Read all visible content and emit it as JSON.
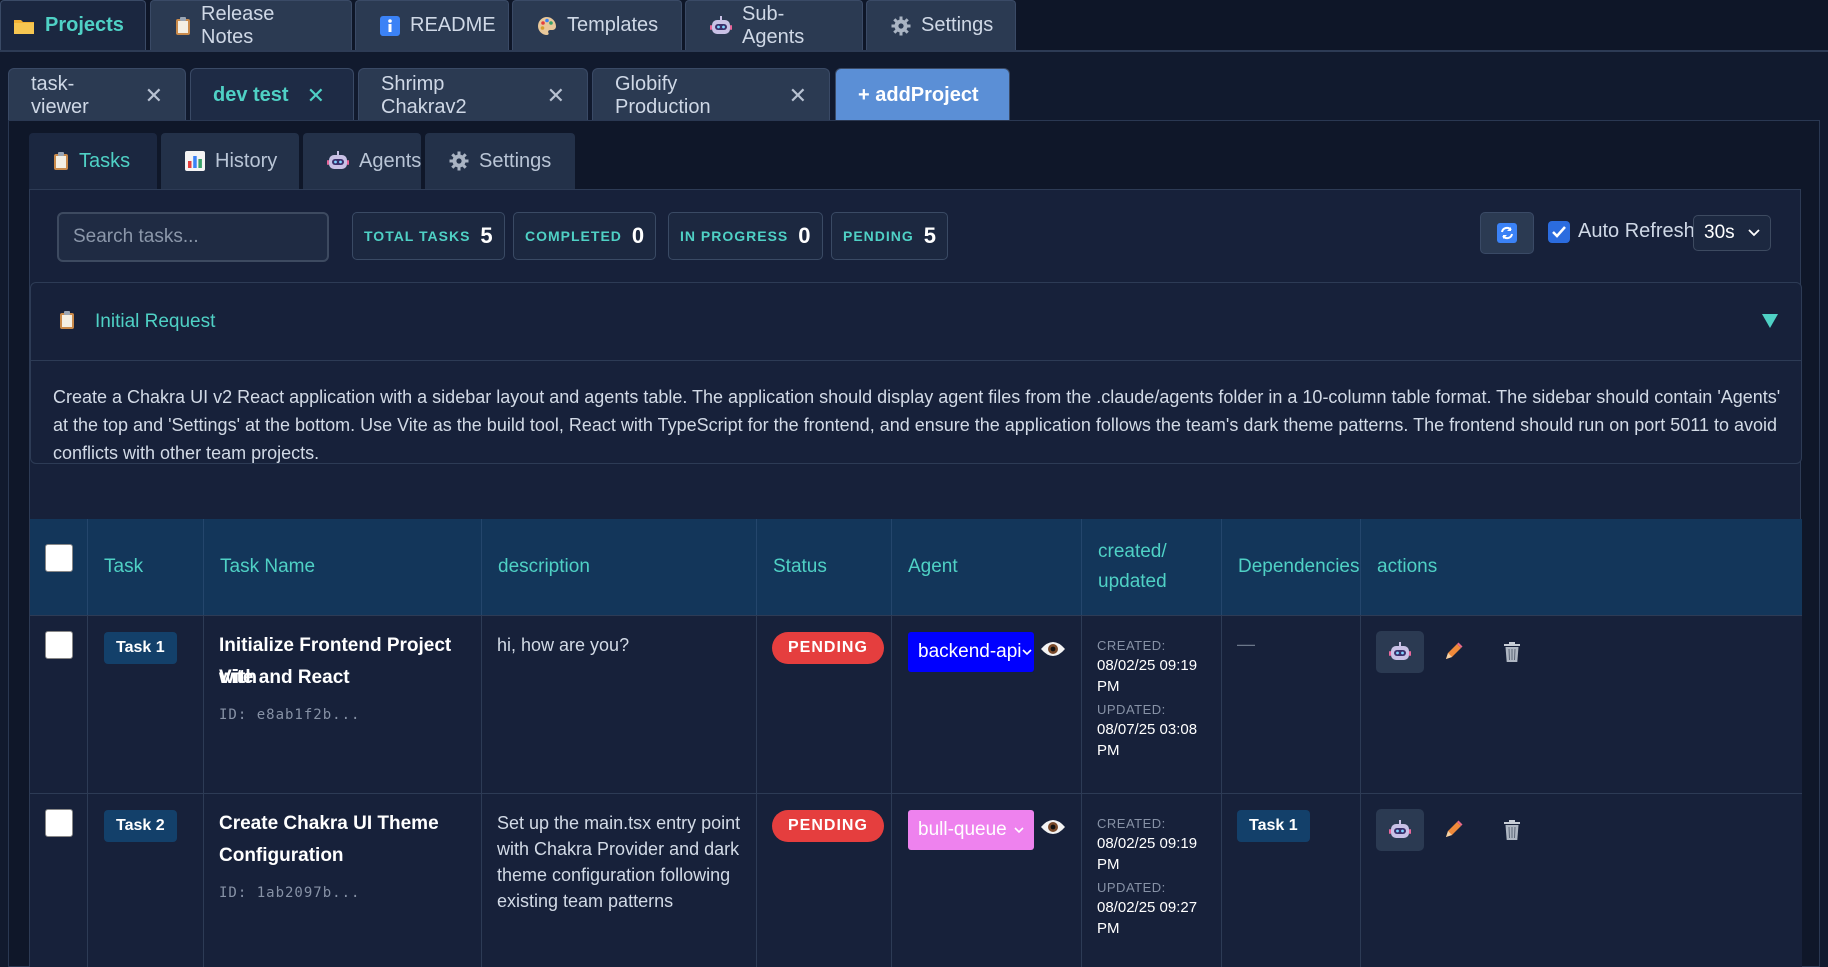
{
  "top_nav": {
    "brand": "Projects",
    "tabs": [
      {
        "label": "Release Notes",
        "icon": "clipboard-icon"
      },
      {
        "label": "README",
        "icon": "info-icon"
      },
      {
        "label": "Templates",
        "icon": "palette-icon"
      },
      {
        "label": "Sub-Agents",
        "icon": "robot-icon"
      },
      {
        "label": "Settings",
        "icon": "gear-icon"
      }
    ]
  },
  "project_tabs": [
    {
      "label": "task-viewer",
      "active": false
    },
    {
      "label": "dev test",
      "active": true
    },
    {
      "label": "Shrimp Chakrav2",
      "active": false
    },
    {
      "label": "Globify Production",
      "active": false
    }
  ],
  "add_project_label": "+ addProject",
  "inner_tabs": [
    {
      "label": "Tasks",
      "icon": "clipboard-icon",
      "active": true
    },
    {
      "label": "History",
      "icon": "bar-chart-icon",
      "active": false
    },
    {
      "label": "Agents",
      "icon": "robot-icon",
      "active": false
    },
    {
      "label": "Settings",
      "icon": "gear-icon",
      "active": false
    }
  ],
  "toolbar": {
    "search_placeholder": "Search tasks...",
    "stats": [
      {
        "label": "TOTAL TASKS",
        "value": "5"
      },
      {
        "label": "COMPLETED",
        "value": "0"
      },
      {
        "label": "IN PROGRESS",
        "value": "0"
      },
      {
        "label": "PENDING",
        "value": "5"
      }
    ],
    "auto_refresh_label": "Auto Refresh",
    "auto_refresh_checked": true,
    "interval": "30s"
  },
  "initial_request": {
    "title": "Initial Request",
    "body": "Create a Chakra UI v2 React application with a sidebar layout and agents table. The application should display agent files from the .claude/agents folder in a 10-column table format. The sidebar should contain 'Agents' at the top and 'Settings' at the bottom. Use Vite as the build tool, React with TypeScript for the frontend, and ensure the application follows the team's dark theme patterns. The frontend should run on port 5011 to avoid conflicts with other team projects."
  },
  "table": {
    "headers": {
      "task": "Task",
      "name": "Task Name",
      "description": "description",
      "status": "Status",
      "agent": "Agent",
      "created_line1": "created/",
      "created_line2": "updated",
      "dependencies": "Dependencies",
      "actions": "actions"
    },
    "rows": [
      {
        "task": "Task 1",
        "name_line1": "Initialize Frontend Project with",
        "name_line2": "Vite and React",
        "id": "ID: e8ab1f2b...",
        "desc_line1": "hi, how are you?",
        "desc_line2": "",
        "desc_line3": "",
        "desc_line4": "",
        "status": "PENDING",
        "agent": "backend-api",
        "agent_bg": "#0000ff",
        "agent_fg": "#ffffff",
        "created_label": "CREATED:",
        "created": "08/02/25 09:19 PM",
        "updated_label": "UPDATED:",
        "updated": "08/07/25 03:08 PM",
        "dependency": "—"
      },
      {
        "task": "Task 2",
        "name_line1": "Create Chakra UI Theme",
        "name_line2": "Configuration",
        "id": "ID: 1ab2097b...",
        "desc_line1": "Set up the main.tsx entry point",
        "desc_line2": "with Chakra Provider and dark",
        "desc_line3": "theme configuration following",
        "desc_line4": "existing team patterns",
        "status": "PENDING",
        "agent": "bull-queue",
        "agent_bg": "#ee82ee",
        "agent_fg": "#ffffff",
        "created_label": "CREATED:",
        "created": "08/02/25 09:19 PM",
        "updated_label": "UPDATED:",
        "updated": "08/02/25 09:27 PM",
        "dependency": "Task 1"
      }
    ]
  },
  "colors": {
    "accent": "#4fd1c5",
    "status_pending": "#e53e3e",
    "add_project": "#5b8fd6",
    "header_bg": "#13365a"
  }
}
